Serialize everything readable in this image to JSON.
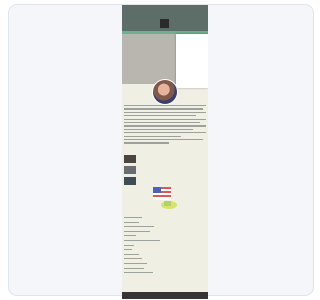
{
  "menu": {
    "items": [
      "",
      "",
      "",
      "",
      "",
      "",
      "",
      "",
      ""
    ]
  },
  "content": {
    "hero_title": "",
    "hero_subtitle": "",
    "posts": [
      {
        "title": ""
      },
      {
        "title": ""
      },
      {
        "title": ""
      }
    ],
    "sidebar_heading": "",
    "footer_text": ""
  },
  "colors": {
    "header": "#5d6d67",
    "accent_green": "#6fae90",
    "hero_title": "#b24a3c",
    "footer": "#343534"
  }
}
